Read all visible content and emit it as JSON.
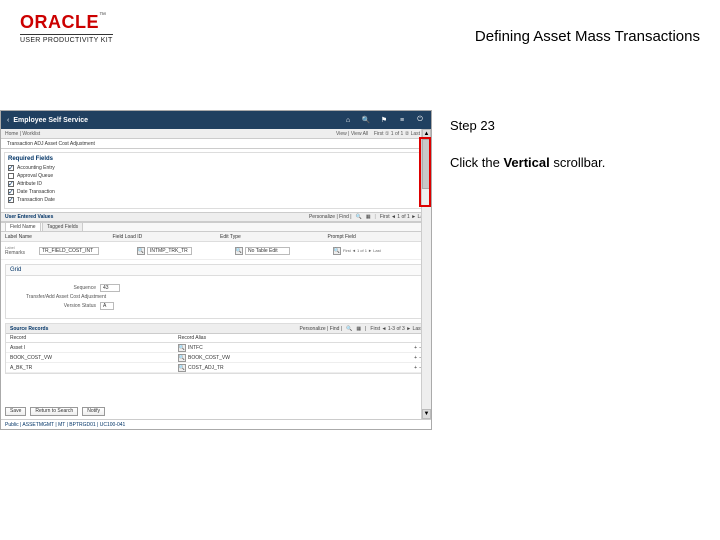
{
  "header": {
    "logo": "ORACLE",
    "logo_tm": "™",
    "logo_sub": "USER PRODUCTIVITY KIT",
    "page_title": "Defining Asset Mass Transactions"
  },
  "step": {
    "label": "Step 23",
    "instruction_pre": "Click the ",
    "instruction_bold": "Vertical",
    "instruction_post": " scrollbar."
  },
  "app": {
    "back": "‹",
    "title": "Employee Self Service",
    "viewer_label": "View | View All",
    "nav_info": "First  ① 1 of 1 ② Last",
    "icons": {
      "home": "home-icon",
      "search": "search-icon",
      "flag": "flag-icon",
      "menu": "menu-icon",
      "power": "power-icon"
    },
    "breadcrumb": "Home  |  Worklist",
    "trans_title": "Transaction  ADJ  Asset Cost Adjustment",
    "section1": {
      "title": "Required Fields",
      "rows": [
        {
          "checked": true,
          "text": "Accounting Entry"
        },
        {
          "checked": false,
          "text": "Approval Queue"
        },
        {
          "checked": true,
          "text": "Attribute ID"
        },
        {
          "checked": true,
          "text": "Date Transaction"
        },
        {
          "checked": true,
          "text": "Transaction Date"
        }
      ]
    },
    "section2": {
      "title": "User Entered Values",
      "tabs": [
        "Field Name",
        "Tagged Fields"
      ],
      "pers_label": "Personalize | Find |",
      "nav_right": "First  ◄ 1 of 1 ► Last",
      "headers": [
        "Label Name",
        "Field Load ID",
        "Edit Type",
        "Prompt Field"
      ],
      "row": {
        "label": "Remarks",
        "field": "TR_FIELD_COST_INT",
        "lookup1_val": "INTMP_TRK_TR",
        "edittype": "No Table Edit",
        "last_nav": "First ◄ 1 of 1 ► Last"
      }
    },
    "grid": {
      "title": "Grid",
      "seq_label": "Sequence",
      "seq_val": "43",
      "reason_label": "Transfer/Add Asset Cost Adjustment",
      "ver_label": "Version Status",
      "ver_val": "A"
    },
    "source": {
      "title": "Source Records",
      "pers_label": "Personalize | Find |",
      "nav": "First  ◄ 1-3 of 3 ► Last",
      "col1": "Record",
      "col2": "Record Alias",
      "rows": [
        {
          "r": "Asset I",
          "a": "INTFC"
        },
        {
          "r": "BOOK_COST_VW",
          "a": "BOOK_COST_VW"
        },
        {
          "r": "A_BK_TR",
          "a": "COST_ADJ_TR"
        }
      ]
    },
    "footer": {
      "btn_save": "Save",
      "btn_return": "Return to Search",
      "btn_notify": "Notify",
      "status": "Public  |  ASSETMGMT  |  MT  |  BPTRGD01  |  UC100-041"
    }
  }
}
